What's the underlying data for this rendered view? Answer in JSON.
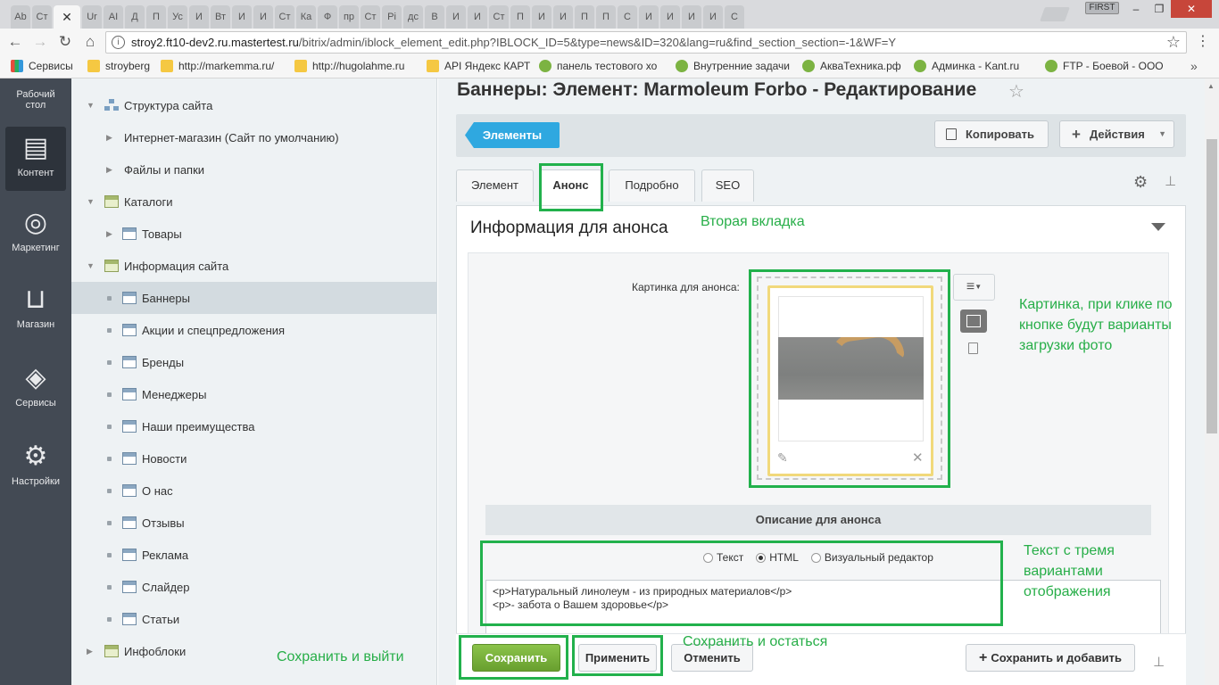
{
  "browser": {
    "tabs": [
      "Ab",
      "Ст",
      "",
      "Ur",
      "АI",
      "Д",
      "П",
      "Ус",
      "И",
      "Вт",
      "И",
      "И",
      "Ст",
      "Ка",
      "Ф",
      "пр",
      "Ст",
      "Pi",
      "дс",
      "В",
      "И",
      "И",
      "Ст",
      "П",
      "И",
      "И",
      "П",
      "П",
      "С",
      "И",
      "И",
      "И",
      "И",
      "С"
    ],
    "active_tab_close": "✕",
    "profile_badge": "FIRST",
    "win_min": "–",
    "win_max": "❐",
    "win_close": "✕",
    "url_host": "stroy2.ft10-dev2.ru.mastertest.ru",
    "url_path": "/bitrix/admin/iblock_element_edit.php?IBLOCK_ID=5&type=news&ID=320&lang=ru&find_section_section=-1&WF=Y",
    "bookmarks": [
      {
        "label": "Сервисы",
        "icon": "apps"
      },
      {
        "label": "stroyberg",
        "icon": "folder"
      },
      {
        "label": "http://markemma.ru/",
        "icon": "folder"
      },
      {
        "label": "http://hugolahme.ru",
        "icon": "folder"
      },
      {
        "label": "API Яндекс КАРТ",
        "icon": "folder"
      },
      {
        "label": "панель тестового хо",
        "icon": "green"
      },
      {
        "label": "Внутренние задачи",
        "icon": "green"
      },
      {
        "label": "АкваТехника.рф",
        "icon": "green"
      },
      {
        "label": "Админка   - Kant.ru",
        "icon": "green"
      },
      {
        "label": "FTP - Боевой - ООО",
        "icon": "green"
      }
    ],
    "bookmarks_more": "»"
  },
  "left_panel": {
    "desktop": "Рабочий стол",
    "content": "Контент",
    "marketing": "Маркетинг",
    "shop": "Магазин",
    "services": "Сервисы",
    "settings": "Настройки"
  },
  "tree": [
    {
      "label": "Структура сайта",
      "level": 0,
      "arrow": "▼",
      "icon": "struct"
    },
    {
      "label": "Интернет-магазин (Сайт по умолчанию)",
      "level": 1,
      "arrow": "▶",
      "icon": ""
    },
    {
      "label": "Файлы и папки",
      "level": 1,
      "arrow": "▶",
      "icon": ""
    },
    {
      "label": "Каталоги",
      "level": 0,
      "arrow": "▼",
      "icon": "cat"
    },
    {
      "label": "Товары",
      "level": 1,
      "arrow": "▶",
      "icon": "doc"
    },
    {
      "label": "Информация сайта",
      "level": 0,
      "arrow": "▼",
      "icon": "cat"
    },
    {
      "label": "Баннеры",
      "level": 2,
      "arrow": "",
      "icon": "doc",
      "selected": true
    },
    {
      "label": "Акции и спецпредложения",
      "level": 2,
      "arrow": "",
      "icon": "doc"
    },
    {
      "label": "Бренды",
      "level": 2,
      "arrow": "",
      "icon": "doc"
    },
    {
      "label": "Менеджеры",
      "level": 2,
      "arrow": "",
      "icon": "doc"
    },
    {
      "label": "Наши преимущества",
      "level": 2,
      "arrow": "",
      "icon": "doc"
    },
    {
      "label": "Новости",
      "level": 2,
      "arrow": "",
      "icon": "doc"
    },
    {
      "label": "О нас",
      "level": 2,
      "arrow": "",
      "icon": "doc"
    },
    {
      "label": "Отзывы",
      "level": 2,
      "arrow": "",
      "icon": "doc"
    },
    {
      "label": "Реклама",
      "level": 2,
      "arrow": "",
      "icon": "doc"
    },
    {
      "label": "Слайдер",
      "level": 2,
      "arrow": "",
      "icon": "doc"
    },
    {
      "label": "Статьи",
      "level": 2,
      "arrow": "",
      "icon": "doc"
    },
    {
      "label": "Инфоблоки",
      "level": 0,
      "arrow": "▶",
      "icon": "cat"
    }
  ],
  "page": {
    "title": "Баннеры: Элемент: Marmoleum Forbo - Редактирование",
    "elements_button": "Элементы",
    "copy_button": "Копировать",
    "actions_button": "Действия",
    "tabs": [
      "Элемент",
      "Анонс",
      "Подробно",
      "SEO"
    ],
    "section_title": "Информация для анонса",
    "picture_label": "Картинка для анонса:",
    "description_heading": "Описание для анонса",
    "radio_options": [
      {
        "label": "Текст",
        "checked": false
      },
      {
        "label": "HTML",
        "checked": true
      },
      {
        "label": "Визуальный редактор",
        "checked": false
      }
    ],
    "description_value": "<p>Натуральный линолеум - из природных материалов</p>\n<p>- забота о Вашем здоровье</p>",
    "save_button": "Сохранить",
    "apply_button": "Применить",
    "cancel_button": "Отменить",
    "save_add_button": "Сохранить и добавить"
  },
  "annotations": {
    "second_tab": "Вторая вкладка",
    "picture": "Картинка, при клике по кнопке будут варианты загрузки фото",
    "text": "Текст с тремя вариантами отображения",
    "save_exit": "Сохранить и выйти",
    "save_stay": "Сохранить и остаться"
  },
  "colors": {
    "annotation_green": "#22b14c",
    "accent_blue": "#2fa8e0",
    "save_green": "#7ab23f",
    "left_panel": "#434a54"
  }
}
